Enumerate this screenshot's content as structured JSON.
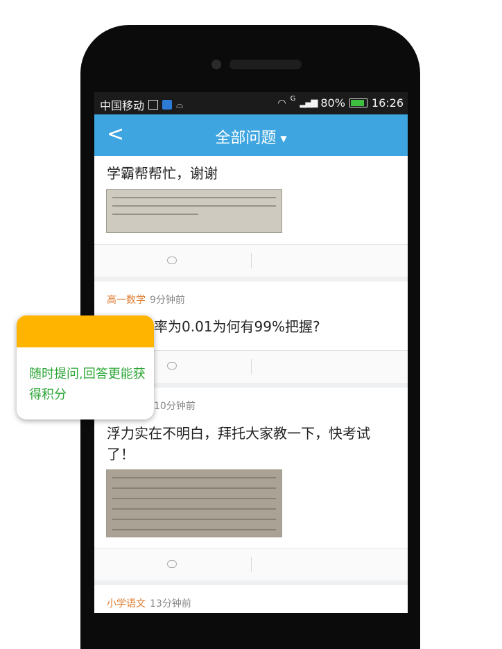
{
  "status_bar": {
    "carrier": "中国移动",
    "network": "G",
    "battery": "80%",
    "time": "16:26"
  },
  "navbar": {
    "title": "全部问题"
  },
  "feed": [
    {
      "subject": "",
      "time": "",
      "question": "学霸帮帮忙，谢谢",
      "has_image": true
    },
    {
      "subject": "高一数学",
      "time": "9分钟前",
      "question": "率为0.01为何有99%把握?",
      "has_image": false
    },
    {
      "subject": "",
      "time": "10分钟前",
      "question": "浮力实在不明白，拜托大家教一下，快考试了！",
      "has_image": true
    },
    {
      "subject": "小学语文",
      "time": "13分钟前",
      "question": "",
      "has_image": false
    }
  ],
  "tooltip": {
    "text": "随时提问,回答更能获得积分"
  },
  "colors": {
    "navbar": "#3ea5e0",
    "subject": "#e07a2c",
    "tooltip_bar": "#ffb400",
    "tooltip_text": "#2aa534"
  }
}
